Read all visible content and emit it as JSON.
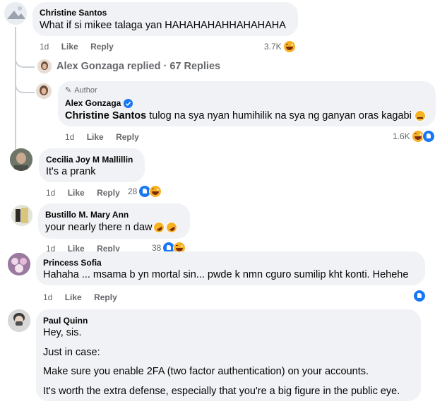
{
  "c1": {
    "name": "Christine Santos",
    "text": "What if si mikee talaga yan HAHAHAHAHHAHAHAHA",
    "time": "1d",
    "like": "Like",
    "reply": "Reply",
    "count": "3.7K"
  },
  "replies_link": {
    "text": "Alex Gonzaga replied · 67 Replies"
  },
  "c2": {
    "badge": "Author",
    "name": "Alex Gonzaga",
    "mention": "Christine Santos",
    "text": " tulog na sya nyan humihilik na sya ng ganyan oras kagabi",
    "time": "1d",
    "like": "Like",
    "reply": "Reply",
    "count": "1.6K"
  },
  "c3": {
    "name": "Cecilia Joy M Mallillin",
    "text": "It's a prank",
    "time": "1d",
    "like": "Like",
    "reply": "Reply",
    "count": "28"
  },
  "c4": {
    "name": "Bustillo M. Mary Ann",
    "text": "your nearly there n daw",
    "time": "1d",
    "like": "Like",
    "reply": "Reply",
    "count": "38"
  },
  "c5": {
    "name": "Princess Sofia",
    "text": "Hahaha ... msama b yn mortal sin... pwde k nmn cguro sumilip kht konti. Hehehe",
    "time": "1d",
    "like": "Like",
    "reply": "Reply"
  },
  "c6": {
    "name": "Paul Quinn",
    "lines": [
      "Hey, sis.",
      "Just in case:",
      "Make sure you enable 2FA (two factor authentication) on your accounts.",
      "It's worth the extra defense, especially that you're a big figure in the public eye."
    ]
  },
  "colors": {
    "bubble": "#f0f2f5",
    "meta": "#65676b",
    "verified": "#1877f2"
  }
}
